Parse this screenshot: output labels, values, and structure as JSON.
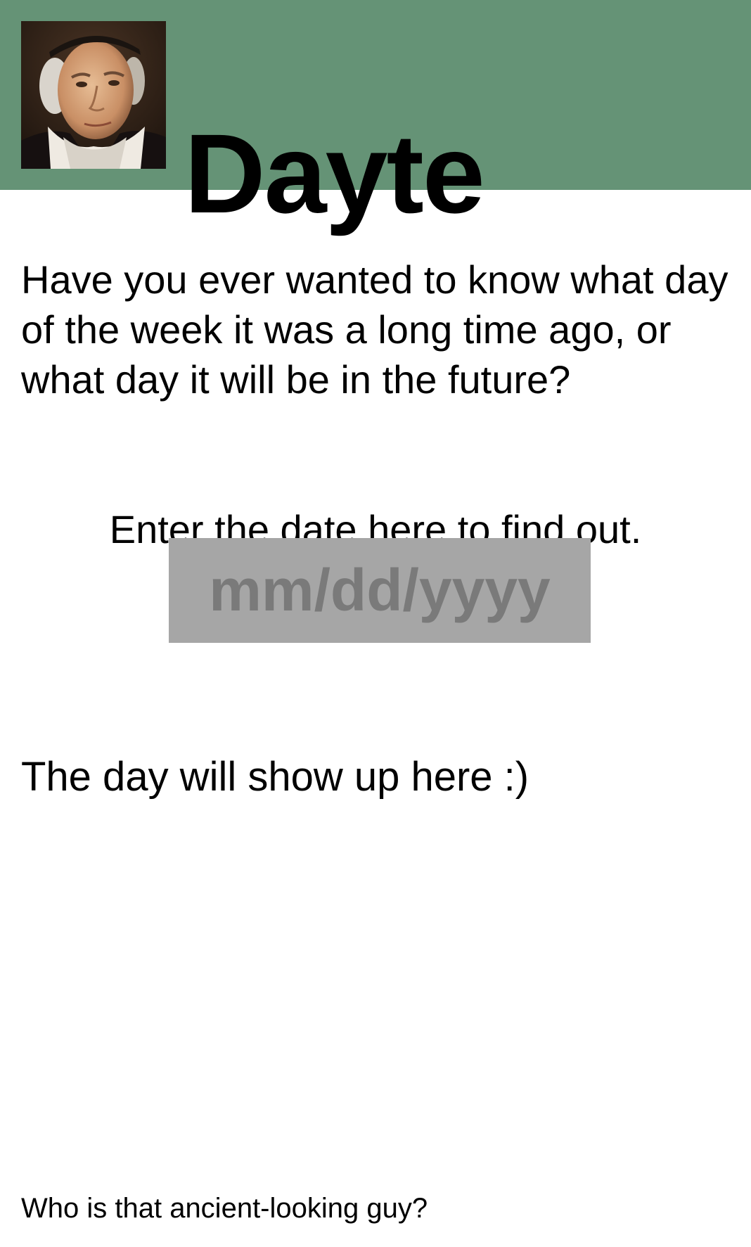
{
  "header": {
    "title": "Dayte",
    "background_color": "#659376",
    "portrait": {
      "icon": "portrait-photo"
    }
  },
  "main": {
    "intro_text": "Have you ever wanted to know what day of the week it was a long time ago, or what day it will be in the future?",
    "prompt_text": "Enter the date here to find out.",
    "date_input": {
      "placeholder": "mm/dd/yyyy",
      "value": "",
      "background_color": "#a6a6a6"
    },
    "result_text": "The day will show up here :)"
  },
  "footer": {
    "link_text": "Who is that ancient-looking guy?"
  }
}
